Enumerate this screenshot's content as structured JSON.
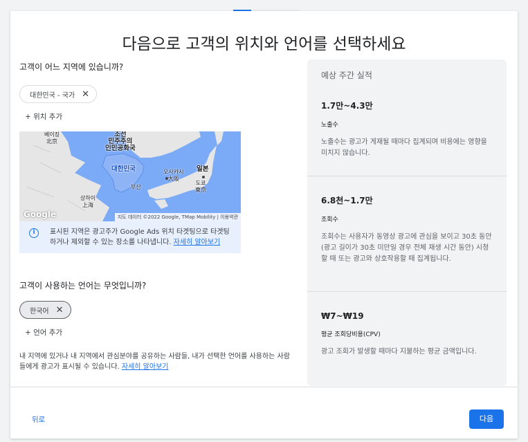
{
  "progress": {
    "fraction": 0.27
  },
  "title": "다음으로 고객의 위치와 언어를 선택하세요",
  "location": {
    "question": "고객이 어느 지역에 있습니까?",
    "chip_label": "대한민국 - 국가",
    "chip_remove": "✕",
    "add_label": "+ 위치 추가",
    "map": {
      "labels": {
        "beijing": "베이징\n北京",
        "nk": "조선\n민주주의\n인민공화국",
        "korea": "대한민국",
        "busan": "부산",
        "osaka": "오사카시\n大阪",
        "japan": "일본",
        "tokyo": "도쿄\n東京",
        "shanghai": "상하이\n上海"
      },
      "attribution": "지도 데이터 ©2022 Google, TMap Mobility | 이용약관",
      "logo": "Google"
    },
    "info_text": "표시된 지역은 광고주가 Google Ads 위치 타겟팅으로 타겟팅하거나 제외할 수 있는 장소를 나타냅니다.",
    "info_link": "자세히 알아보기"
  },
  "language": {
    "question": "고객이 사용하는 언어는 무엇입니까?",
    "chip_label": "한국어",
    "chip_remove": "✕",
    "add_label": "+ 언어 추가",
    "footnote": "내 지역에 있거나 내 지역에서 관심분야를 공유하는 사람들, 내가 선택한 언어를 사용하는 사람들에게 광고가 표시될 수 있습니다.",
    "footnote_link": "자세히 알아보기"
  },
  "results": {
    "heading": "예상 주간 실적",
    "metrics": [
      {
        "value": "1.7만~4.3만",
        "label": "노출수",
        "desc": "노출수는 광고가 게재될 때마다 집계되며 비용에는 영향을 미치지 않습니다."
      },
      {
        "value": "6.8천~1.7만",
        "label": "조회수",
        "desc": "조회수는 사용자가 동영상 광고에 관심을 보이고 30초 동안(광고 길이가 30초 미만일 경우 전체 재생 시간 동안) 시청할 때 또는 광고와 상호작용할 때 집계됩니다."
      },
      {
        "value": "₩7~₩19",
        "label": "평균 조회당비용(CPV)",
        "desc": "광고 조회가 발생할 때마다 지불하는 평균 금액입니다."
      }
    ]
  },
  "footer": {
    "back_label": "뒤로",
    "next_label": "다음"
  },
  "colors": {
    "accent": "#1a73e8",
    "map_water": "#7baaf7",
    "map_region": "#a8c7fa"
  }
}
